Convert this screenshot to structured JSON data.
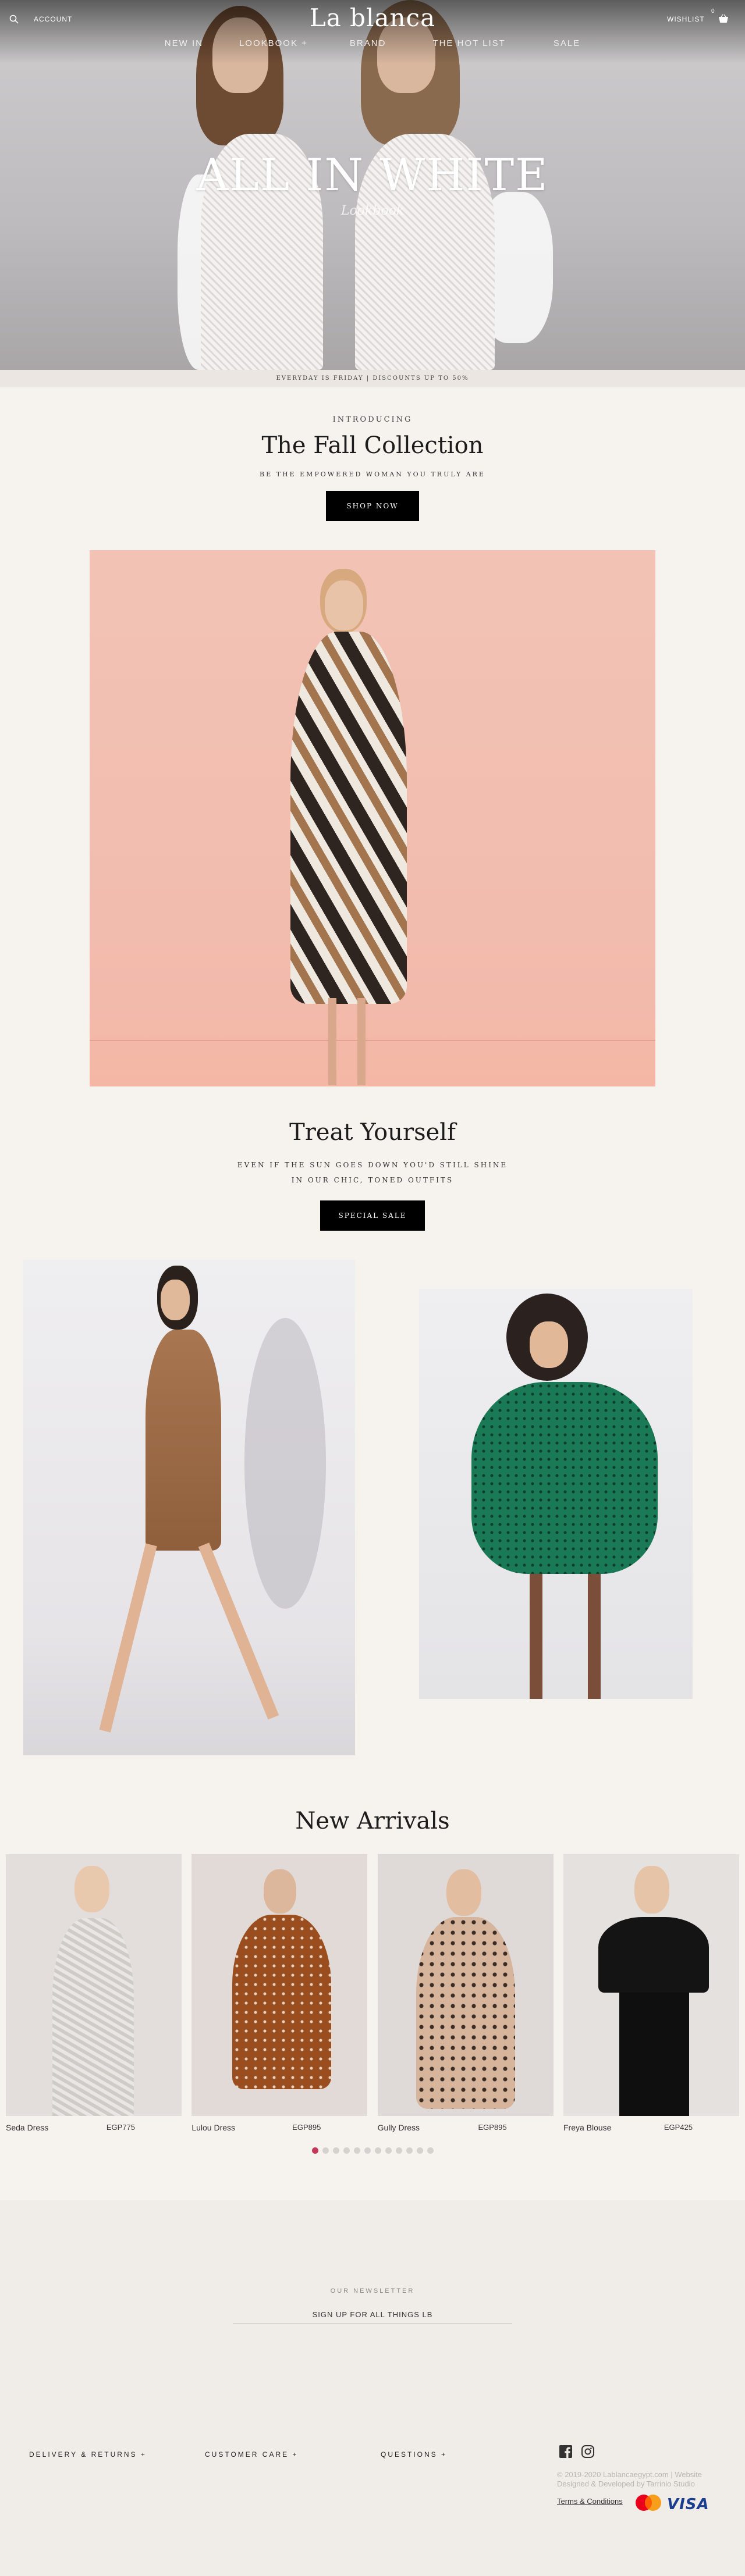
{
  "header": {
    "account_label": "ACCOUNT",
    "wishlist_label": "WISHLIST",
    "basket_count": "0",
    "logo": "La blanca",
    "nav": [
      "NEW IN",
      "LOOKBOOK +",
      "BRAND",
      "THE HOT LIST",
      "SALE"
    ]
  },
  "hero": {
    "title": "ALL IN WHITE",
    "subtitle": "Lookbook"
  },
  "promo_strip": "EVERYDAY IS FRIDAY | DISCOUNTS UP TO 50%",
  "fall_collection": {
    "eyebrow": "INTRODUCING",
    "title": "The Fall Collection",
    "tagline": "BE THE EMPOWERED WOMAN YOU TRULY ARE",
    "button": "SHOP NOW"
  },
  "treat": {
    "title": "Treat Yourself",
    "line1": "EVEN IF THE SUN GOES DOWN YOU'D STILL SHINE",
    "line2": "IN OUR CHIC, TONED OUTFITS",
    "button": "SPECIAL SALE"
  },
  "arrivals": {
    "title": "New Arrivals",
    "products": [
      {
        "name": "Seda Dress",
        "price": "EGP775"
      },
      {
        "name": "Lulou Dress",
        "price": "EGP895"
      },
      {
        "name": "Gully Dress",
        "price": "EGP895"
      },
      {
        "name": "Freya Blouse",
        "price": "EGP425"
      }
    ],
    "carousel_dots": 12,
    "carousel_active": 1
  },
  "newsletter": {
    "eyebrow": "OUR NEWSLETTER",
    "placeholder": "SIGN UP FOR ALL THINGS LB"
  },
  "footer": {
    "links": [
      "DELIVERY & RETURNS +",
      "CUSTOMER CARE +",
      "QUESTIONS +"
    ],
    "copyright": "© 2019-2020 Lablancaegypt.com | Website Designed & Developed by Tarrinio Studio",
    "terms": "Terms & Conditions",
    "card_visa": "VISA"
  },
  "colors": {
    "background": "#f6f3ef",
    "button": "#000000",
    "carousel_active": "#c6385b",
    "footer_bg": "#f0ece8"
  }
}
